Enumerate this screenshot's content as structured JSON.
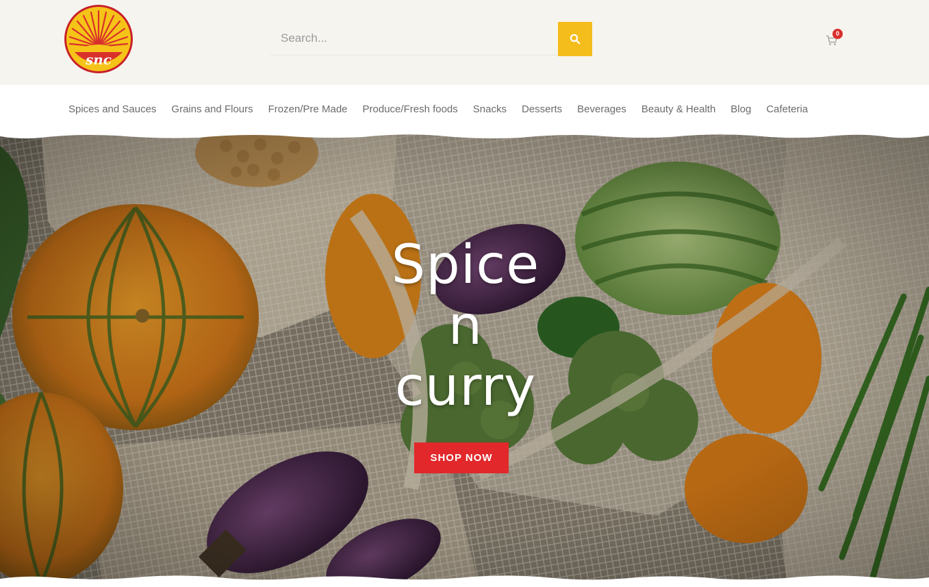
{
  "header": {
    "logo_text": "snc",
    "search": {
      "placeholder": "Search..."
    },
    "cart": {
      "count": "0"
    }
  },
  "nav": {
    "items": [
      {
        "label": "Spices and Sauces"
      },
      {
        "label": "Grains and Flours"
      },
      {
        "label": "Frozen/Pre Made"
      },
      {
        "label": "Produce/Fresh foods"
      },
      {
        "label": "Snacks"
      },
      {
        "label": "Desserts"
      },
      {
        "label": "Beverages"
      },
      {
        "label": "Beauty & Health"
      },
      {
        "label": "Blog"
      },
      {
        "label": "Cafeteria"
      }
    ]
  },
  "hero": {
    "title_line1": "Spice",
    "title_line2": "n",
    "title_line3": "curry",
    "cta_label": "SHOP NOW"
  },
  "colors": {
    "header_bg": "#f6f4ef",
    "search_button": "#f4bd1b",
    "cta": "#e2282a",
    "badge": "#d9302c",
    "nav_text": "#6b6b6b"
  },
  "icons": {
    "search": "search-icon",
    "cart": "cart-icon",
    "logo": "sun-logo"
  }
}
